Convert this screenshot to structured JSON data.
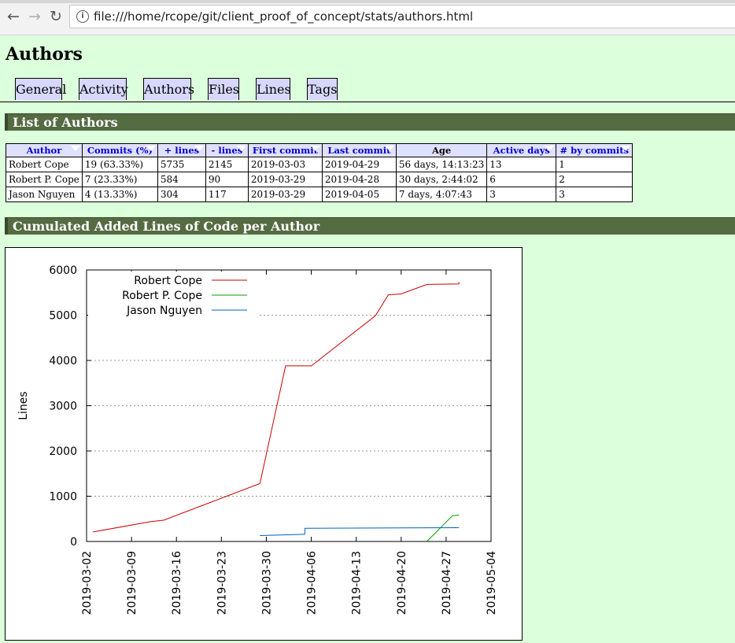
{
  "browser": {
    "url": "file:///home/rcope/git/client_proof_of_concept/stats/authors.html",
    "back_icon": "←",
    "forward_icon": "→",
    "reload_icon": "↻",
    "info_icon": "i"
  },
  "page": {
    "title": "Authors",
    "tabs": [
      "General",
      "Activity",
      "Authors",
      "Files",
      "Lines",
      "Tags"
    ],
    "section_authors": "List of Authors",
    "section_chart": "Cumulated Added Lines of Code per Author"
  },
  "authors_table": {
    "headers": [
      "Author",
      "Commits (%)",
      "+ lines",
      "- lines",
      "First commit",
      "Last commit",
      "Age",
      "Active days",
      "# by commits"
    ],
    "rows": [
      [
        "Robert Cope",
        "19 (63.33%)",
        "5735",
        "2145",
        "2019-03-03",
        "2019-04-29",
        "56 days, 14:13:23",
        "13",
        "1"
      ],
      [
        "Robert P. Cope",
        "7 (23.33%)",
        "584",
        "90",
        "2019-03-29",
        "2019-04-28",
        "30 days, 2:44:02",
        "6",
        "2"
      ],
      [
        "Jason Nguyen",
        "4 (13.33%)",
        "304",
        "117",
        "2019-03-29",
        "2019-04-05",
        "7 days, 4:07:43",
        "3",
        "3"
      ]
    ]
  },
  "chart_data": {
    "type": "line",
    "title": "",
    "xlabel": "",
    "ylabel": "Lines",
    "ylim": [
      0,
      6000
    ],
    "yticks": [
      0,
      1000,
      2000,
      3000,
      4000,
      5000,
      6000
    ],
    "xlim": [
      "2019-03-02",
      "2019-05-04"
    ],
    "xticks": [
      "2019-03-02",
      "2019-03-09",
      "2019-03-16",
      "2019-03-23",
      "2019-03-30",
      "2019-04-06",
      "2019-04-13",
      "2019-04-20",
      "2019-04-27",
      "2019-05-04"
    ],
    "grid": "horizontal dotted",
    "legend": "top-left",
    "series": [
      {
        "name": "Robert Cope",
        "color": "#cc0000",
        "points": [
          [
            "2019-03-03",
            210
          ],
          [
            "2019-03-12",
            440
          ],
          [
            "2019-03-14",
            470
          ],
          [
            "2019-03-29",
            1280
          ],
          [
            "2019-04-02",
            3880
          ],
          [
            "2019-04-06",
            3880
          ],
          [
            "2019-04-16",
            4990
          ],
          [
            "2019-04-18",
            5450
          ],
          [
            "2019-04-20",
            5470
          ],
          [
            "2019-04-24",
            5680
          ],
          [
            "2019-04-29",
            5690
          ],
          [
            "2019-04-29",
            5735
          ]
        ]
      },
      {
        "name": "Robert P. Cope",
        "color": "#00a000",
        "points": [
          [
            "2019-04-24",
            0
          ],
          [
            "2019-04-28",
            570
          ],
          [
            "2019-04-29",
            584
          ]
        ]
      },
      {
        "name": "Jason Nguyen",
        "color": "#0060c0",
        "points": [
          [
            "2019-03-29",
            130
          ],
          [
            "2019-04-05",
            160
          ],
          [
            "2019-04-05",
            290
          ],
          [
            "2019-04-29",
            304
          ]
        ]
      }
    ]
  }
}
